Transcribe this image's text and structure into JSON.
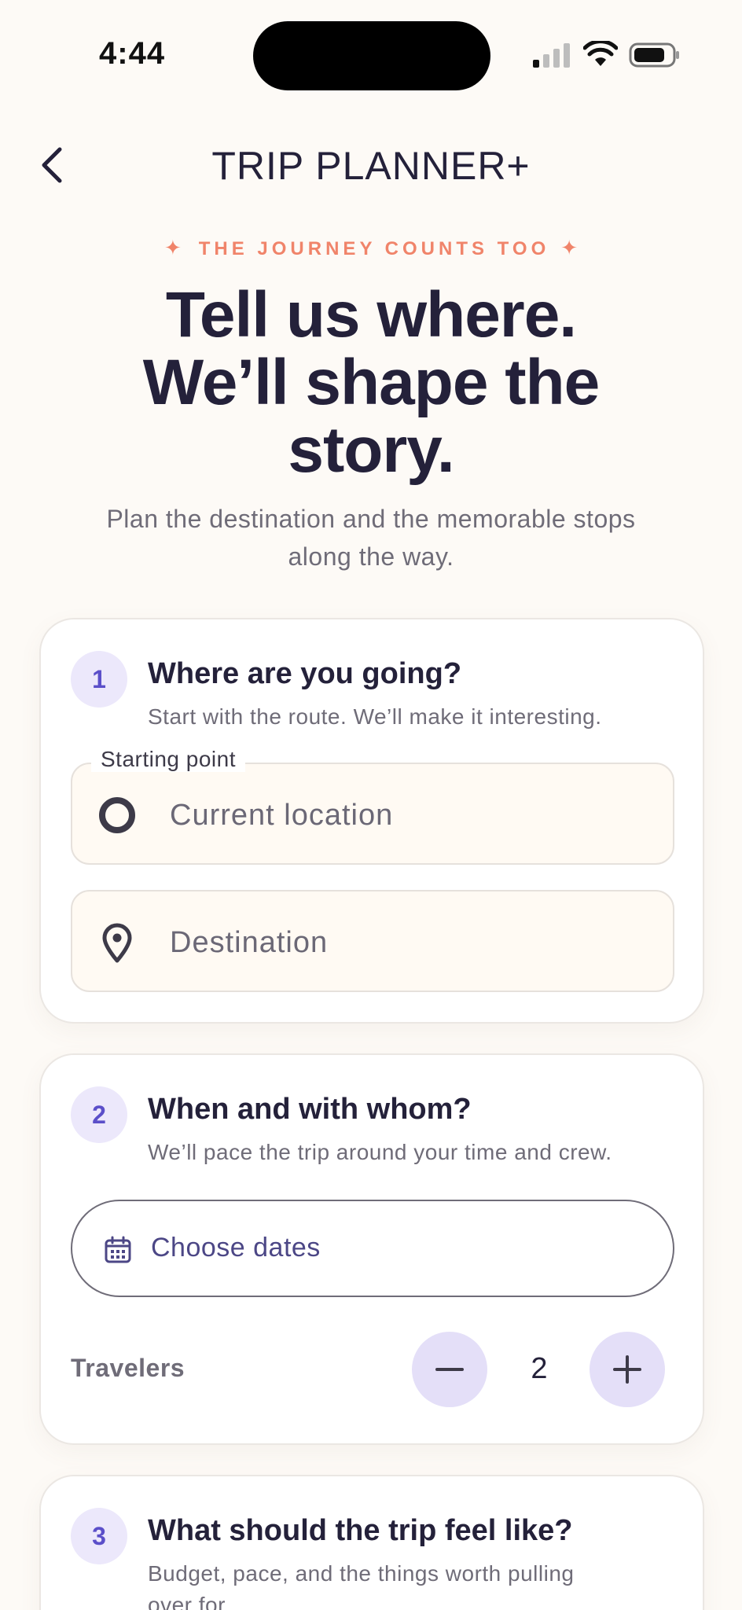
{
  "status_bar": {
    "time": "4:44",
    "icons": [
      "signal-icon",
      "wifi-icon",
      "battery-icon"
    ]
  },
  "header": {
    "title": "TRIP PLANNER+",
    "back_icon": "chevron-left-icon"
  },
  "hero": {
    "eyebrow": "THE JOURNEY COUNTS TOO",
    "eyebrow_spark": "✦",
    "title_line1": "Tell us where.",
    "title_line2": "We’ll shape the",
    "title_line3": "story.",
    "subtitle_line1": "Plan the destination and the memorable stops",
    "subtitle_line2": "along the way."
  },
  "steps": [
    {
      "number": "1",
      "title": "Where are you going?",
      "subtitle": "Start with the route. We’ll make it interesting.",
      "start_field": {
        "label": "Starting point",
        "placeholder": "Current location",
        "icon": "circle-origin-icon"
      },
      "destination_field": {
        "placeholder": "Destination",
        "icon": "map-pin-icon"
      }
    },
    {
      "number": "2",
      "title": "When and with whom?",
      "subtitle": "We’ll pace the trip around your time and crew.",
      "dates_button": {
        "label": "Choose dates",
        "icon": "calendar-icon"
      },
      "travelers": {
        "label": "Travelers",
        "count": "2",
        "decrement_icon": "minus-icon",
        "increment_icon": "plus-icon"
      }
    },
    {
      "number": "3",
      "title": "What should the trip feel like?",
      "subtitle_line1": "Budget, pace, and the things worth pulling",
      "subtitle_line2": "over for."
    }
  ],
  "colors": {
    "background": "#fdfaf6",
    "accent_coral": "#f0846a",
    "accent_purple": "#5b4fc9",
    "badge_bg": "#ece8fb",
    "stepper_bg": "#e4dff8",
    "ink": "#24213a"
  }
}
